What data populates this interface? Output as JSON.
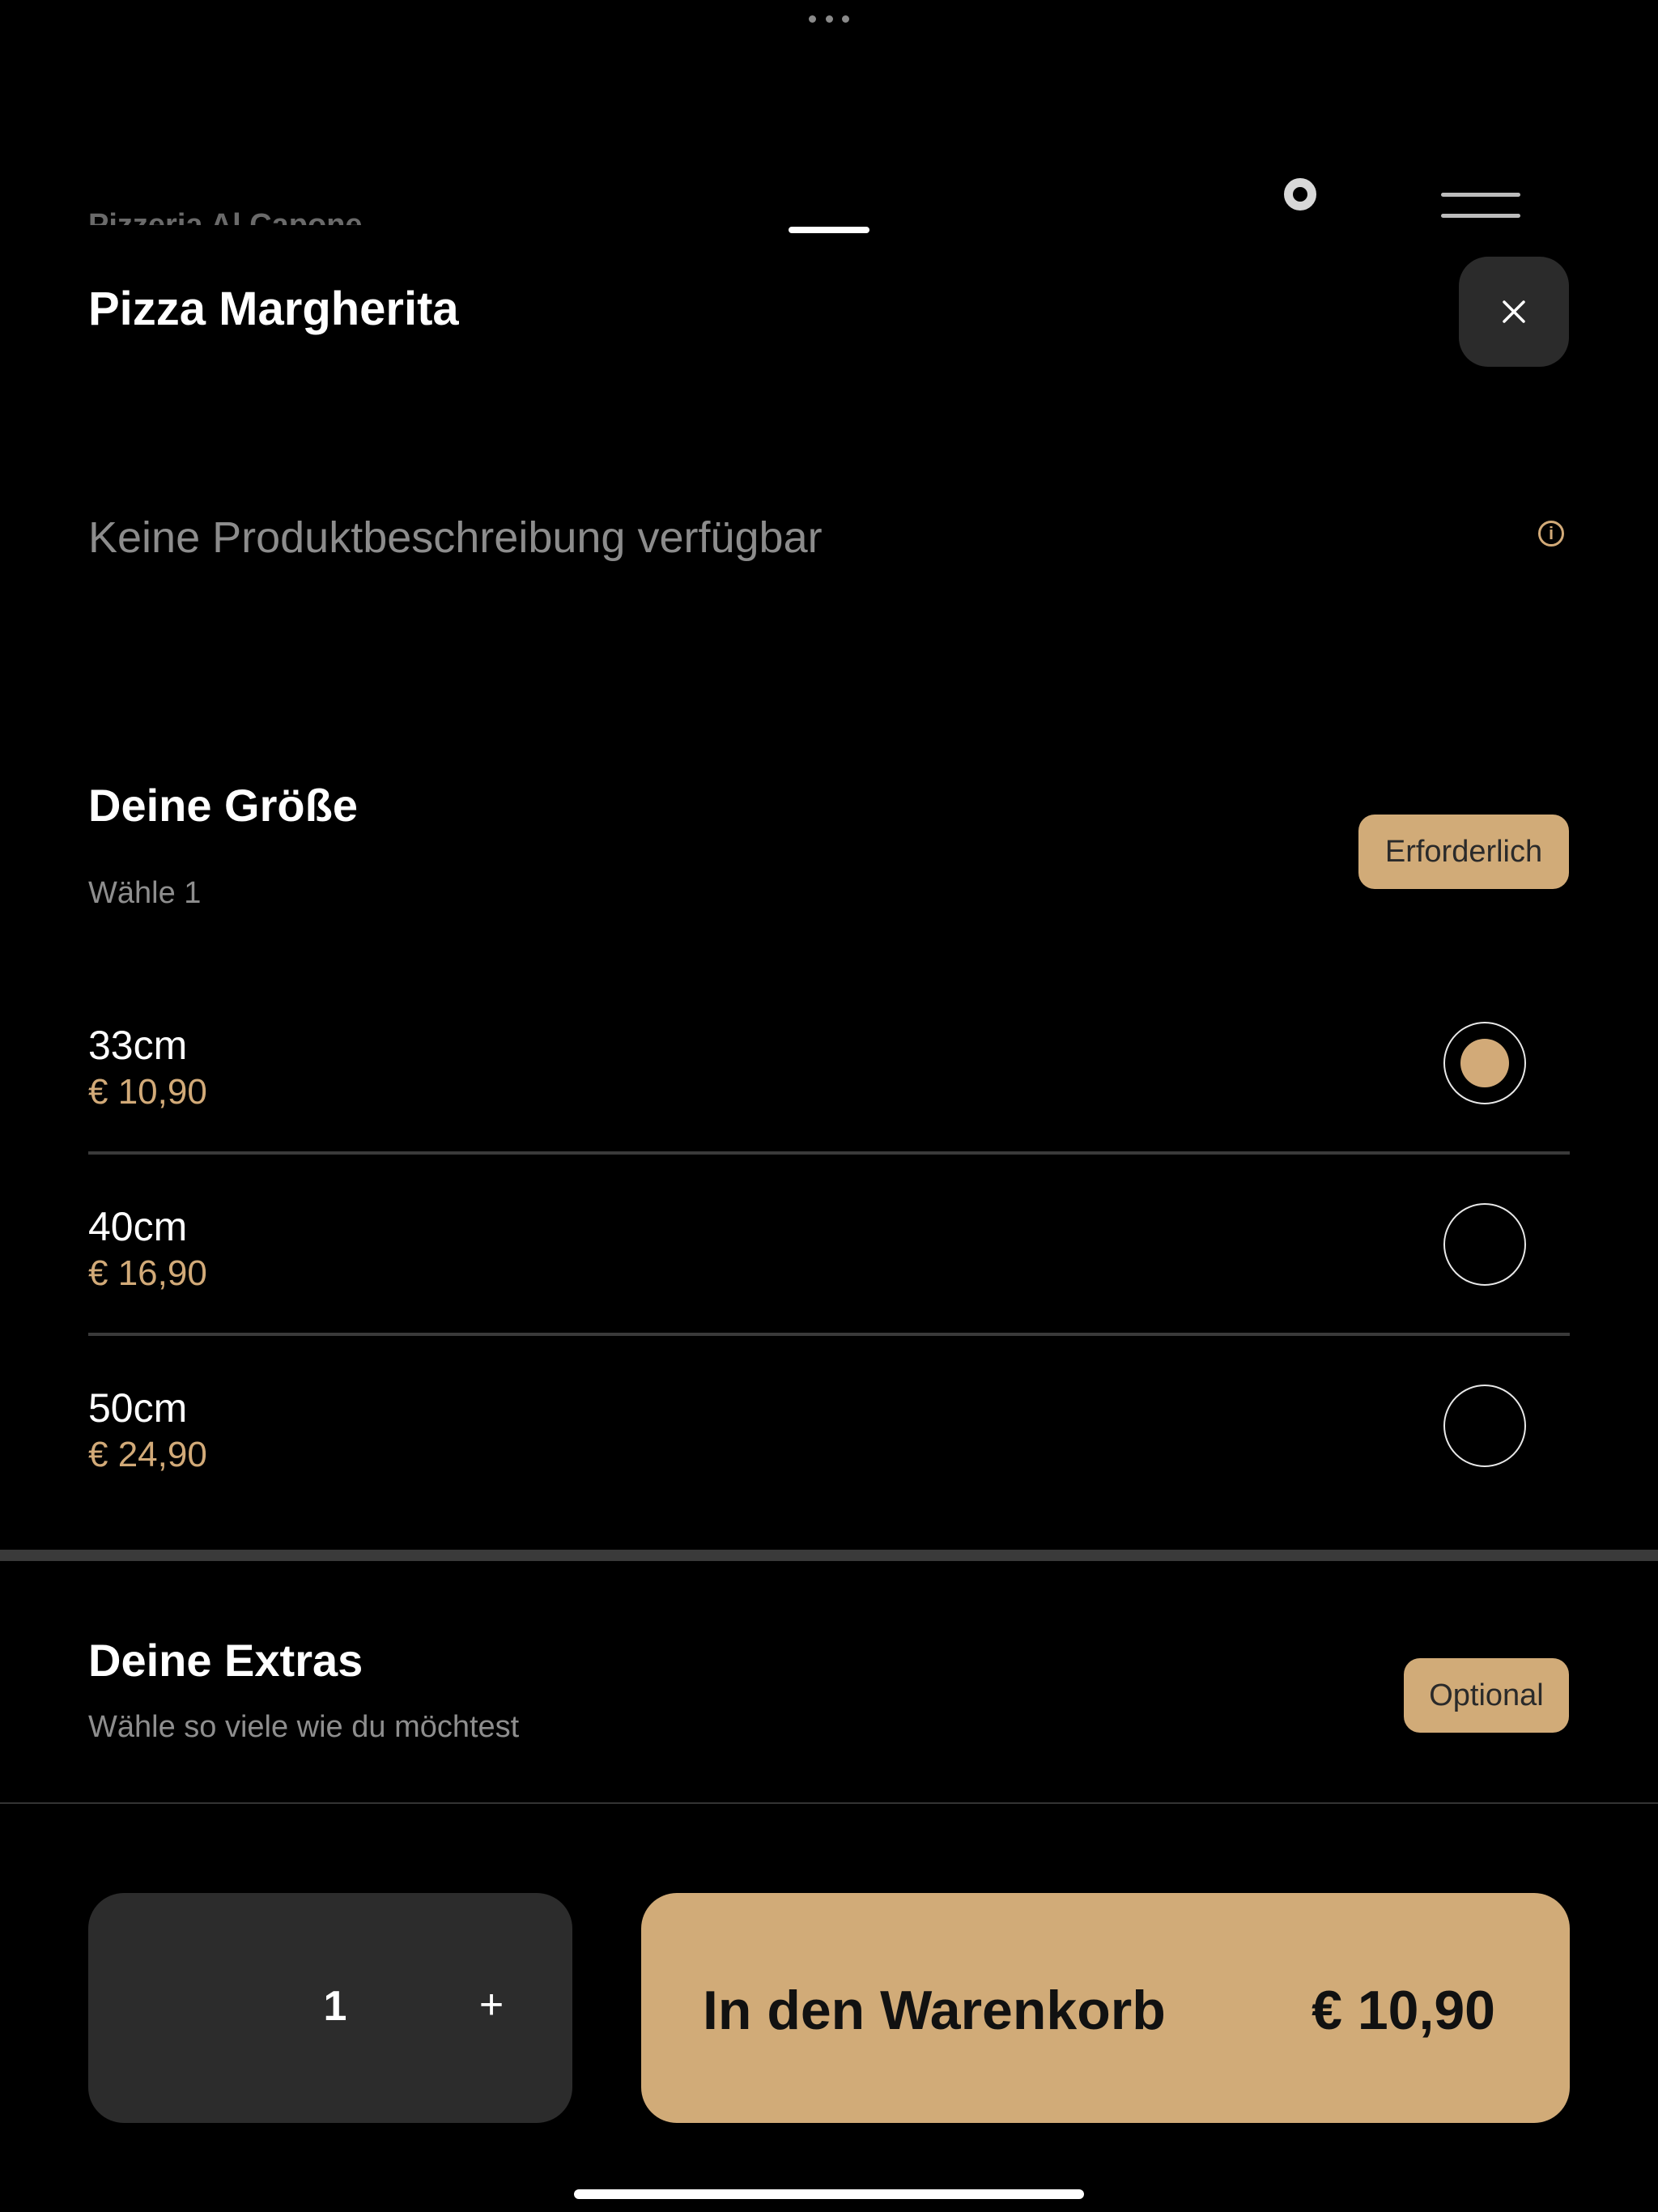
{
  "background_header": {
    "title": "Pizzeria Al Capone"
  },
  "product": {
    "title": "Pizza Margherita",
    "description": "Keine Produktbeschreibung verfügbar",
    "close_icon": "close-icon",
    "info_icon": "info-icon"
  },
  "size_section": {
    "title": "Deine Größe",
    "subtitle": "Wähle 1",
    "badge": "Erforderlich",
    "options": [
      {
        "label": "33cm",
        "price": "€ 10,90",
        "selected": true
      },
      {
        "label": "40cm",
        "price": "€ 16,90",
        "selected": false
      },
      {
        "label": "50cm",
        "price": "€ 24,90",
        "selected": false
      }
    ]
  },
  "extras_section": {
    "title": "Deine Extras",
    "subtitle": "Wähle so viele wie du möchtest",
    "badge": "Optional"
  },
  "quantity": {
    "value": "1",
    "plus": "+"
  },
  "cart_button": {
    "label": "In den Warenkorb",
    "price": "€ 10,90"
  },
  "colors": {
    "accent": "#d1ab78",
    "background": "#000000",
    "surface": "#2c2c2c"
  }
}
